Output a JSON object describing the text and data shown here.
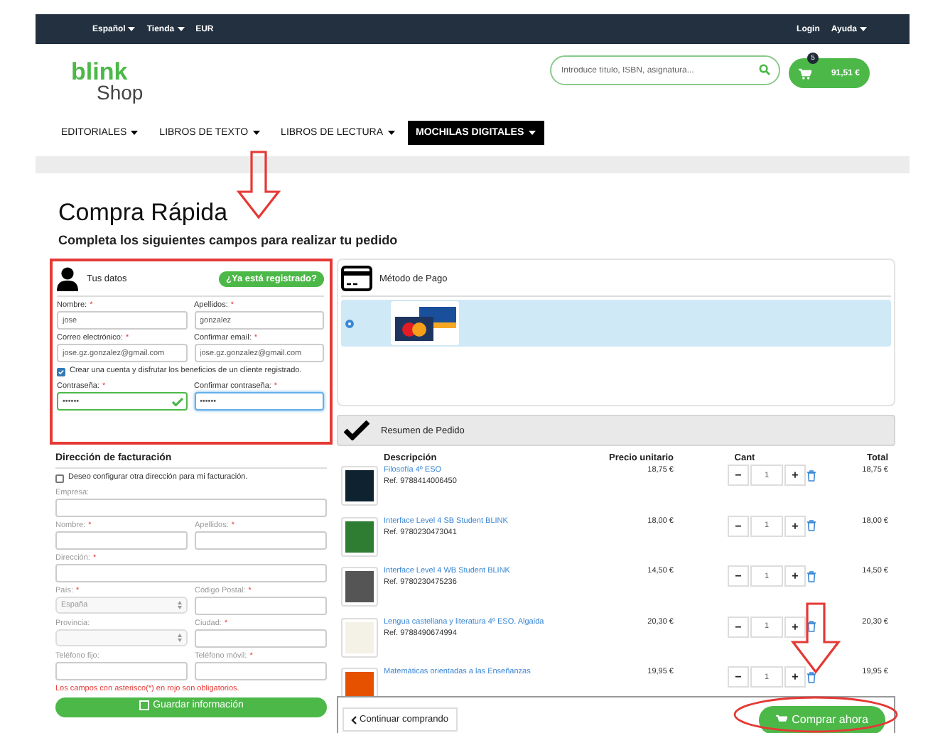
{
  "topbar": {
    "left": [
      {
        "label": "Español",
        "dropdown": true
      },
      {
        "label": "Tienda",
        "dropdown": true
      },
      {
        "label": "EUR",
        "dropdown": false
      }
    ],
    "right": [
      {
        "label": "Login",
        "dropdown": false
      },
      {
        "label": "Ayuda",
        "dropdown": true
      }
    ]
  },
  "header": {
    "logo": {
      "brand": "blink",
      "sub": "Shop"
    },
    "search": {
      "placeholder": "Introduce título, ISBN, asignatura..."
    },
    "cart": {
      "count": "5",
      "total": "91,51 €"
    }
  },
  "nav": [
    {
      "label": "EDITORIALES",
      "selected": false
    },
    {
      "label": "LIBROS DE TEXTO",
      "selected": false
    },
    {
      "label": "LIBROS DE LECTURA",
      "selected": false
    },
    {
      "label": "MOCHILAS DIGITALES",
      "selected": true
    }
  ],
  "title": "Compra Rápida",
  "subtitle": "Completa los siguientes campos para realizar tu pedido",
  "user_panel": {
    "heading": "Tus datos",
    "login_button": "¿Ya está registrado?",
    "rows": [
      [
        {
          "label": "Nombre:",
          "asterisk": "*",
          "value": "jose"
        },
        {
          "label": "Apellidos:",
          "asterisk": "*",
          "value": "gonzalez"
        }
      ],
      [
        {
          "label": "Correo electrónico:",
          "asterisk": "*",
          "value": "jose.gz.gonzalez@gmail.com"
        },
        {
          "label": "Confirmar email:",
          "asterisk": "*",
          "value": "jose.gz.gonzalez@gmail.com"
        }
      ]
    ],
    "create_account": {
      "label": "Crear una cuenta y disfrutar los beneficios de un cliente registrado.",
      "checked": true
    },
    "password_row": [
      {
        "label": "Contraseña:",
        "asterisk": "*",
        "value": "••••••",
        "valid": true,
        "focused": false
      },
      {
        "label": "Confirmar contraseña:",
        "asterisk": "*",
        "value": "••••••",
        "valid": false,
        "focused": true
      }
    ]
  },
  "billing": {
    "heading": "Dirección de facturación",
    "checkbox": {
      "label": "Deseo configurar otra dirección para mi facturación.",
      "checked": false
    },
    "rows": [
      [
        {
          "label": "Empresa:",
          "kind": "text"
        }
      ],
      [
        {
          "label": "Nombre:",
          "asterisk": "*",
          "kind": "text"
        },
        {
          "label": "Apellidos:",
          "asterisk": "*",
          "kind": "text"
        }
      ],
      [
        {
          "label": "Dirección:",
          "asterisk": "*",
          "kind": "text"
        }
      ],
      [
        {
          "label": "País:",
          "asterisk": "*",
          "kind": "select",
          "value": "España"
        },
        {
          "label": "Código Postal:",
          "asterisk": "*",
          "kind": "text"
        }
      ],
      [
        {
          "label": "Provincia:",
          "kind": "select"
        },
        {
          "label": "Ciudad:",
          "asterisk": "*",
          "kind": "text"
        }
      ],
      [
        {
          "label": "Teléfono fijo:",
          "kind": "text"
        },
        {
          "label": "Teléfono móvil:",
          "asterisk": "*",
          "kind": "text"
        }
      ]
    ],
    "note": "Los campos con asterisco(*) en rojo son obligatorios.",
    "save_button": "Guardar información"
  },
  "payment": {
    "heading": "Método de Pago",
    "options": [
      {
        "selected": true
      }
    ]
  },
  "summary": {
    "heading": "Resumen de Pedido",
    "columns": [
      "Descripción",
      "Precio unitario",
      "Cant",
      "Total"
    ],
    "rows": [
      {
        "name": "Filosofía 4º ESO",
        "ref": "Ref. 9788414006450",
        "price": "18,75 €",
        "minus": "−",
        "qty": "1",
        "plus": "+",
        "total": "18,75 €"
      },
      {
        "name": "Interface Level 4 SB Student BLINK",
        "ref": "Ref. 9780230473041",
        "price": "18,00 €",
        "minus": "−",
        "qty": "1",
        "plus": "+",
        "total": "18,00 €"
      },
      {
        "name": "Interface Level 4 WB Student BLINK",
        "ref": "Ref. 9780230475236",
        "price": "14,50 €",
        "minus": "−",
        "qty": "1",
        "plus": "+",
        "total": "14,50 €"
      },
      {
        "name": "Lengua castellana y literatura 4º ESO. Algaida",
        "ref": "Ref. 9788490674994",
        "price": "20,30 €",
        "minus": "−",
        "qty": "1",
        "plus": "+",
        "total": "20,30 €"
      },
      {
        "name": "Matemáticas orientadas a las Enseñanzas",
        "price": "19,95 €",
        "minus": "−",
        "qty": "1",
        "plus": "+",
        "total": "19,95 €"
      }
    ],
    "continue_button": "Continuar comprando",
    "buy_button": "Comprar ahora"
  }
}
